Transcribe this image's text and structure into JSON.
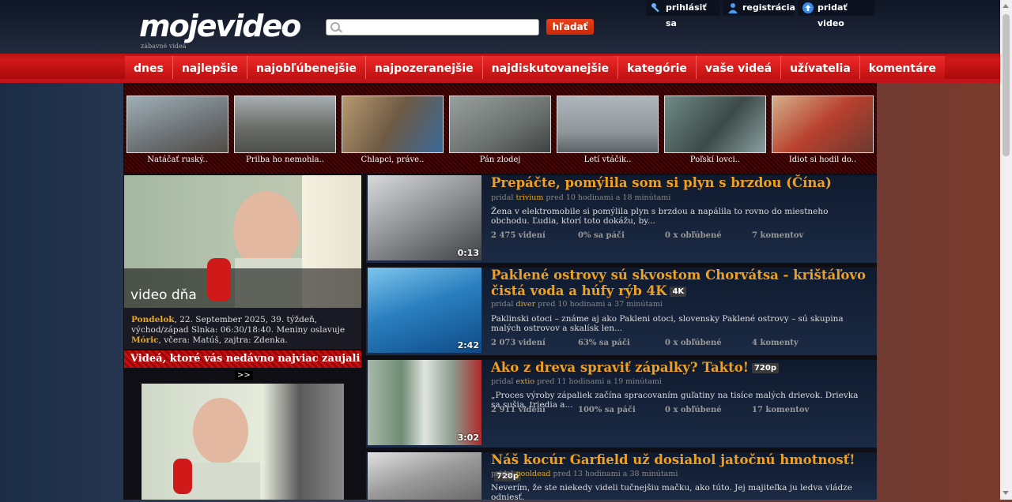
{
  "header": {
    "logo": "mojevideo",
    "tagline": "zábavné videá",
    "search_placeholder": "",
    "search_button": "hľadať",
    "login": "prihlásiť sa",
    "register": "registrácia",
    "add_video": "pridať video"
  },
  "nav": [
    "dnes",
    "najlepšie",
    "najobľúbenejšie",
    "najpozeranejšie",
    "najdiskutovanejšie",
    "kategórie",
    "vaše videá",
    "užívatelia",
    "komentáre"
  ],
  "featured": [
    {
      "caption": "Natáčať ruský..",
      "color": "#7b8a8e"
    },
    {
      "caption": "Prilba ho nemohla..",
      "color": "#6f7470"
    },
    {
      "caption": "Chlapci, práve..",
      "color": "#8a7456"
    },
    {
      "caption": "Pán zlodej",
      "color": "#7c8280"
    },
    {
      "caption": "Letí vtáčik..",
      "color": "#9aa3a8"
    },
    {
      "caption": "Poľskí lovci..",
      "color": "#5d6e6c"
    },
    {
      "caption": "Idiot si hodil do..",
      "color": "#a2665a"
    }
  ],
  "daily": {
    "label": "video dňa",
    "day": "Pondelok",
    "date_text": ", 22. September 2025, 39. týždeň, východ/západ Slnka: 06:30/18:40. Meniny oslavuje ",
    "name": "Móric",
    "after_name": ", včera: Matúš, zajtra: Zdenka."
  },
  "recent": {
    "heading": "Videá, ktoré vás nedávno najviac zaujali",
    "nav": ">>"
  },
  "videos": [
    {
      "title": "Prepáčte, pomýlila som si plyn s brzdou (Čína)",
      "badge": "",
      "added_by": "pridal",
      "user": "trivium",
      "time": "pred 10 hodinami a 18 minútami",
      "desc": "Žena v elektromobile si pomýlila plyn s brzdou a napálila to rovno do miestneho obchodu. Ľudia, ktorí toto dokážu, by...",
      "views": "2 475 videní",
      "likes": "0% sa páči",
      "favs": "0 x obľúbené",
      "comments": "7 komentov",
      "duration": "0:13",
      "thumb_color": "#8c8e92"
    },
    {
      "title": "Paklené ostrovy sú skvostom Chorvátsa - krištáľovo čistá voda a húfy rýb 4K",
      "badge": "4K",
      "added_by": "pridal",
      "user": "diver",
      "time": "pred 10 hodinami a 37 minútami",
      "desc": "Paklinski otoci – známe aj ako Pakleni otoci, slovensky Paklené ostrovy – sú skupina malých ostrovov a skalísk len...",
      "views": "2 073 videní",
      "likes": "63% sa páči",
      "favs": "0 x obľúbené",
      "comments": "4 komenty",
      "duration": "2:42",
      "thumb_color": "#2a7fbf"
    },
    {
      "title": "Ako z dreva spraviť zápalky? Takto!",
      "badge": "720p",
      "added_by": "pridal",
      "user": "extio",
      "time": "pred 11 hodinami a 19 minútami",
      "desc": "„Proces výroby zápaliek začína spracovaním guľatiny na tisíce malých drievok. Drievka sa sušia, triedia a...",
      "views": "2 911 videní",
      "likes": "100% sa páči",
      "favs": "0 x obľúbené",
      "comments": "17 komentov",
      "duration": "3:02",
      "thumb_color": "#8a9a8c"
    },
    {
      "title": "Náš kocúr Garfield už dosiahol jatočnú hmotnosť!",
      "badge": "720p",
      "added_by": "pridal",
      "user": "pooldead",
      "time": "pred 13 hodinami a 38 minútami",
      "desc": "Neverím, že ste niekedy videli tučnejšiu mačku, ako túto. Jej majiteľka ju ledva vládze odniesť.",
      "views": "",
      "likes": "",
      "favs": "",
      "comments": "",
      "duration": "",
      "thumb_color": "#9a9a9a"
    }
  ],
  "colors": {
    "accent": "#e8a81c",
    "nav_red": "#d11818",
    "title_orange": "#f0a020"
  }
}
